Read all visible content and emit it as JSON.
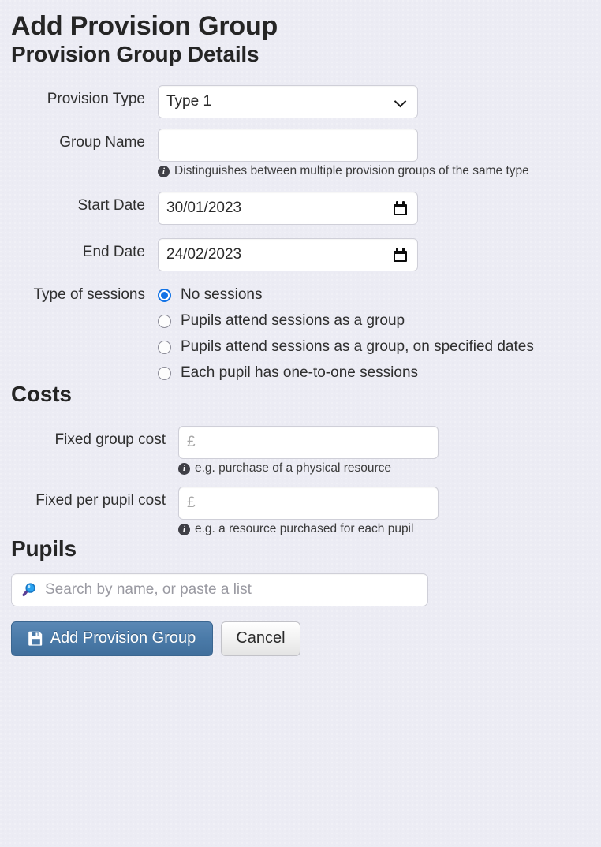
{
  "page": {
    "title": "Add Provision Group"
  },
  "details": {
    "section_title": "Provision Group Details",
    "provision_type": {
      "label": "Provision Type",
      "value": "Type 1",
      "options": [
        "Type 1"
      ]
    },
    "group_name": {
      "label": "Group Name",
      "value": "",
      "placeholder": "",
      "hint": "Distinguishes between multiple provision groups of the same type"
    },
    "start_date": {
      "label": "Start Date",
      "value": "30/01/2023"
    },
    "end_date": {
      "label": "End Date",
      "value": "24/02/2023"
    },
    "session_type": {
      "label": "Type of sessions",
      "selected_index": 0,
      "options": [
        "No sessions",
        "Pupils attend sessions as a group",
        "Pupils attend sessions as a group, on specified dates",
        "Each pupil has one-to-one sessions"
      ]
    }
  },
  "costs": {
    "section_title": "Costs",
    "fixed_group_cost": {
      "label": "Fixed group cost",
      "value": "",
      "placeholder": "£",
      "hint": "e.g. purchase of a physical resource"
    },
    "fixed_per_pupil_cost": {
      "label": "Fixed per pupil cost",
      "value": "",
      "placeholder": "£",
      "hint": "e.g. a resource purchased for each pupil"
    }
  },
  "pupils": {
    "section_title": "Pupils",
    "search": {
      "value": "",
      "placeholder": "Search by name, or paste a list"
    }
  },
  "actions": {
    "submit_label": "Add Provision Group",
    "cancel_label": "Cancel"
  },
  "icons": {
    "chevron_down": "chevron-down-icon",
    "calendar": "calendar-icon",
    "info": "info-icon",
    "search": "search-icon",
    "save": "save-icon"
  },
  "colors": {
    "background": "#ececf4",
    "primary_button": "#4a7aa8",
    "radio_selected": "#1273e6",
    "info_icon": "#3f3f46",
    "text": "#2b2b2b",
    "placeholder": "#a8a8a8"
  }
}
